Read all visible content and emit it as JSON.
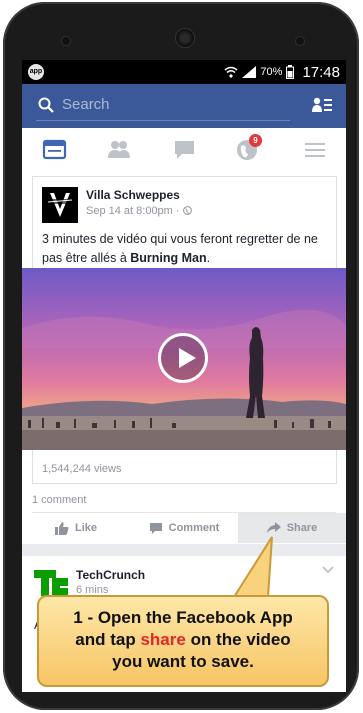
{
  "status": {
    "battery_percent": "70%",
    "time": "17:48",
    "app_icon_label": "app"
  },
  "search": {
    "placeholder": "Search"
  },
  "tabs": {
    "notifications_badge": "9"
  },
  "post": {
    "author": "Villa Schweppes",
    "date": "Sep 14 at 8:00pm",
    "text_prefix": "3 minutes de vidéo qui vous feront regretter de ne pas être allés à ",
    "text_bold": "Burning Man",
    "text_suffix": ".",
    "views": "1,544,244 views",
    "comments": "1 comment",
    "like_label": "Like",
    "comment_label": "Comment",
    "share_label": "Share"
  },
  "post2": {
    "author": "TechCrunch",
    "meta": "6 mins",
    "text_start": "A"
  },
  "callout": {
    "line1": "1  - Open the Facebook App",
    "line2_pre": "and tap ",
    "line2_hl": "share",
    "line2_post": " on the video",
    "line3": "you want to save."
  },
  "colors": {
    "brand": "#3b5998",
    "callout_bg": "#f7c565",
    "highlight": "#e3262a"
  }
}
